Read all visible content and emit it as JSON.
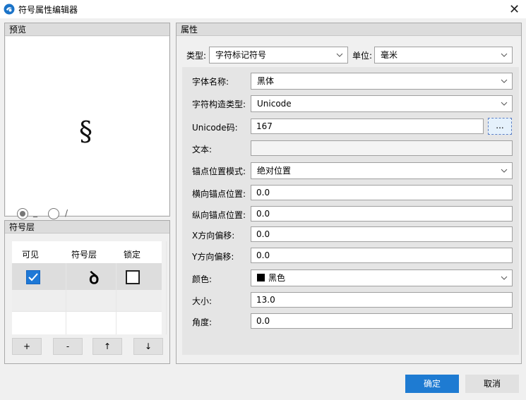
{
  "window": {
    "title": "符号属性编辑器",
    "close_label": "✕"
  },
  "preview": {
    "header": "预览",
    "symbol_glyph": "§",
    "radio_1_label": "_",
    "radio_2_label": "/"
  },
  "layers": {
    "header": "符号层",
    "columns": [
      "可见",
      "符号层",
      "锁定"
    ],
    "row_symbol_glyph": "ꝺ",
    "row_visible_checked": true,
    "row_locked_checked": false,
    "buttons": [
      "+",
      "-",
      "↑",
      "↓"
    ]
  },
  "properties": {
    "header": "属性",
    "type_label": "类型:",
    "type_value": "字符标记符号",
    "unit_label": "单位:",
    "unit_value": "毫米",
    "rows": [
      {
        "label": "字体名称:",
        "value": "黑体"
      },
      {
        "label": "字符构造类型:",
        "value": "Unicode"
      },
      {
        "label": "Unicode码:",
        "value": "167"
      },
      {
        "label": "文本:",
        "value": ""
      },
      {
        "label": "锚点位置模式:",
        "value": "绝对位置"
      },
      {
        "label": "横向锚点位置:",
        "value": "0.0"
      },
      {
        "label": "纵向锚点位置:",
        "value": "0.0"
      },
      {
        "label": "X方向偏移:",
        "value": "0.0"
      },
      {
        "label": "Y方向偏移:",
        "value": "0.0"
      },
      {
        "label": "颜色:",
        "value": "黑色"
      },
      {
        "label": "大小:",
        "value": "13.0"
      },
      {
        "label": "角度:",
        "value": "0.0"
      }
    ],
    "dots_button": "...",
    "color_swatch": "#000000"
  },
  "footer": {
    "ok_label": "确定",
    "cancel_label": "取消"
  },
  "colors": {
    "accent": "#1e7bd2",
    "checkbox_checked": "#1e78d6"
  }
}
